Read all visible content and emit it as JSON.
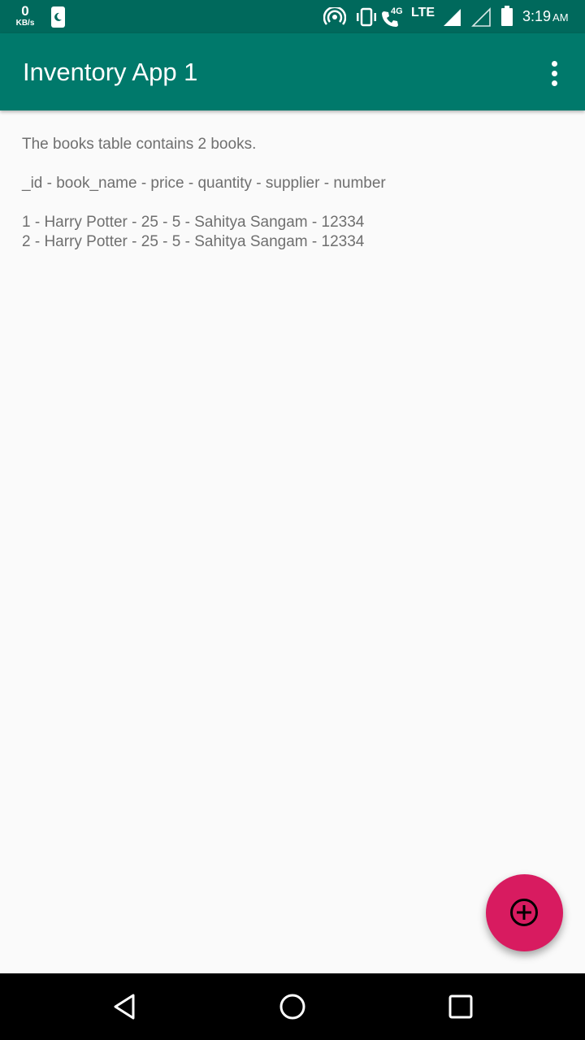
{
  "status_bar": {
    "speed_value": "0",
    "speed_unit": "KB/s",
    "network_4g": "4G",
    "network_lte": "LTE",
    "time": "3:19",
    "ampm": "AM",
    "icons": [
      "moon-notification-icon",
      "hotspot-icon",
      "vibrate-icon",
      "wifi-calling-icon",
      "signal-icon",
      "signal-empty-icon",
      "battery-icon"
    ]
  },
  "app_bar": {
    "title": "Inventory App 1",
    "overflow_icon": "more-vert-icon"
  },
  "content": {
    "summary": "The books table contains 2 books.",
    "header": "_id - book_name - price - quantity - supplier - number",
    "rows": [
      "1 - Harry Potter - 25 - 5 - Sahitya Sangam - 12334",
      "2 - Harry Potter - 25 - 5 - Sahitya Sangam - 12334"
    ]
  },
  "fab": {
    "icon": "add-circle-icon",
    "color": "#d81b60"
  },
  "nav_bar": {
    "icons": [
      "back-icon",
      "home-icon",
      "recents-icon"
    ]
  },
  "colors": {
    "status_bar": "#00695c",
    "app_bar": "#00796b",
    "accent": "#d81b60",
    "background": "#fafafa"
  }
}
